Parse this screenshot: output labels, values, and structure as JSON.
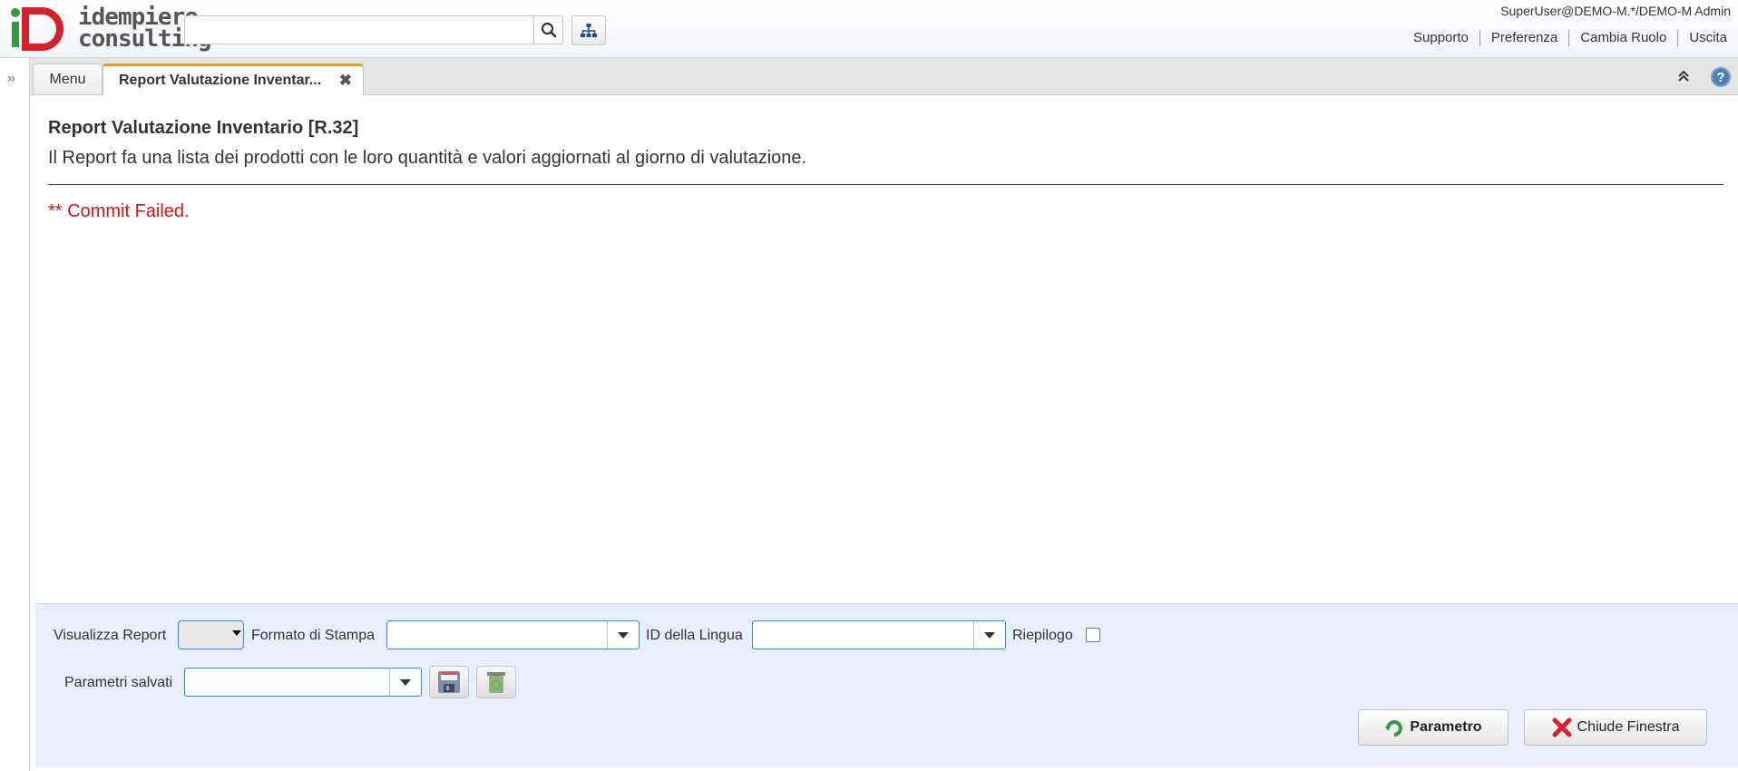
{
  "header": {
    "logo_line1": "idempiere",
    "logo_line2": "consulting",
    "search_placeholder": "",
    "user": "SuperUser@DEMO-M.*/DEMO-M Admin",
    "links": [
      "Supporto",
      "Preferenza",
      "Cambia Ruolo",
      "Uscita"
    ]
  },
  "tabs": {
    "menu_label": "Menu",
    "active_label": "Report Valutazione Inventar...",
    "close_glyph": "✖"
  },
  "content": {
    "title": "Report Valutazione Inventario [R.32]",
    "description": "Il Report fa una lista dei prodotti con le loro quantità e valori aggiornati al giorno di valutazione.",
    "error": "** Commit Failed."
  },
  "params": {
    "view_report_label": "Visualizza Report",
    "print_format_label": "Formato di Stampa",
    "print_format_value": "",
    "language_label": "ID della Lingua",
    "language_value": "",
    "summary_label": "Riepilogo",
    "saved_params_label": "Parametri salvati",
    "saved_params_value": ""
  },
  "buttons": {
    "parameter": "Parametro",
    "close_window": "Chiude Finestra"
  },
  "colors": {
    "accent": "#2a8bd6",
    "tab_active_border": "#f09a1d",
    "error": "#e01010",
    "panel_bg": "#e8eefb"
  }
}
